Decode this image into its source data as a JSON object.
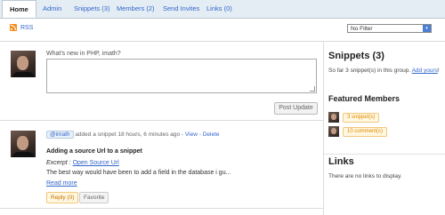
{
  "tabs": [
    {
      "label": "Home",
      "active": true
    },
    {
      "label": "Admin"
    },
    {
      "label": "Snippets (3)"
    },
    {
      "label": "Members (2)"
    },
    {
      "label": "Send Invites"
    },
    {
      "label": "Links (0)"
    }
  ],
  "rss_label": "RSS",
  "filter": {
    "selected": "No Filter"
  },
  "compose": {
    "label": "What's new in PHP, imath?",
    "button": "Post Update"
  },
  "activity": {
    "user": "@imath",
    "action": "added a snippet",
    "time": "18 hours, 6 minutes ago -",
    "view_link": "View",
    "sep": "-",
    "delete_link": "Delete",
    "title": "Adding a source Url to a snippet",
    "excerpt_label": "Excerpt :",
    "excerpt_link": "Open Source Url",
    "body": "The best way would have been to add a field in the database i gu...",
    "read_more": "Read more",
    "reply_label": "Reply (0)",
    "favorite_label": "Favorite"
  },
  "sidebar": {
    "snippets_title": "Snippets (3)",
    "snippets_text": "So far 3 snippet(s) in this group.",
    "add_yours": "Add yours",
    "add_yours_suffix": "!",
    "featured_title": "Featured Members",
    "members": [
      {
        "count": "3 snippet(s)"
      },
      {
        "count": "10 comment(s)"
      }
    ],
    "links_title": "Links",
    "links_text": "There are no links to display."
  },
  "colors": {
    "link": "#3366cc",
    "tab_bar": "#e4edf4",
    "badge_orange": "#e08a00"
  }
}
